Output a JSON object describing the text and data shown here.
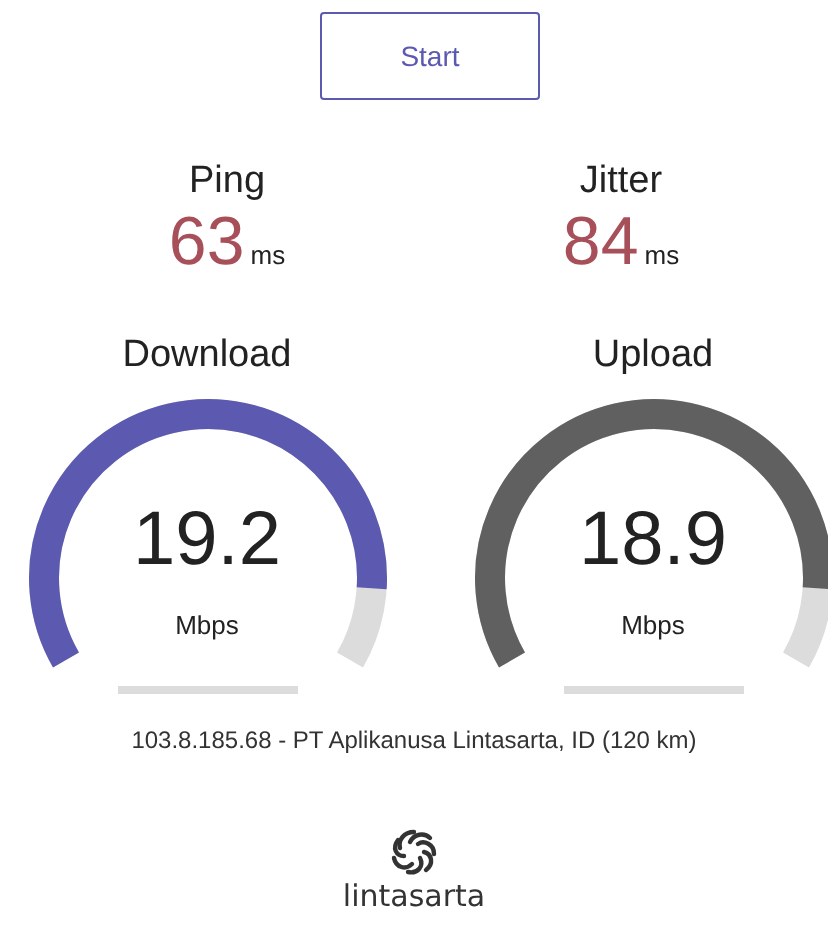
{
  "start_button": {
    "label": "Start"
  },
  "stats": [
    {
      "label": "Ping",
      "value": "63",
      "unit": "ms"
    },
    {
      "label": "Jitter",
      "value": "84",
      "unit": "ms"
    }
  ],
  "gauges": [
    {
      "label": "Download",
      "value": "19.2",
      "unit": "Mbps",
      "color": "#5b59b0"
    },
    {
      "label": "Upload",
      "value": "18.9",
      "unit": "Mbps",
      "color": "#606060"
    }
  ],
  "server": "103.8.185.68 - PT Aplikanusa Lintasarta, ID (120 km)",
  "logo": {
    "text": "lintasarta"
  }
}
